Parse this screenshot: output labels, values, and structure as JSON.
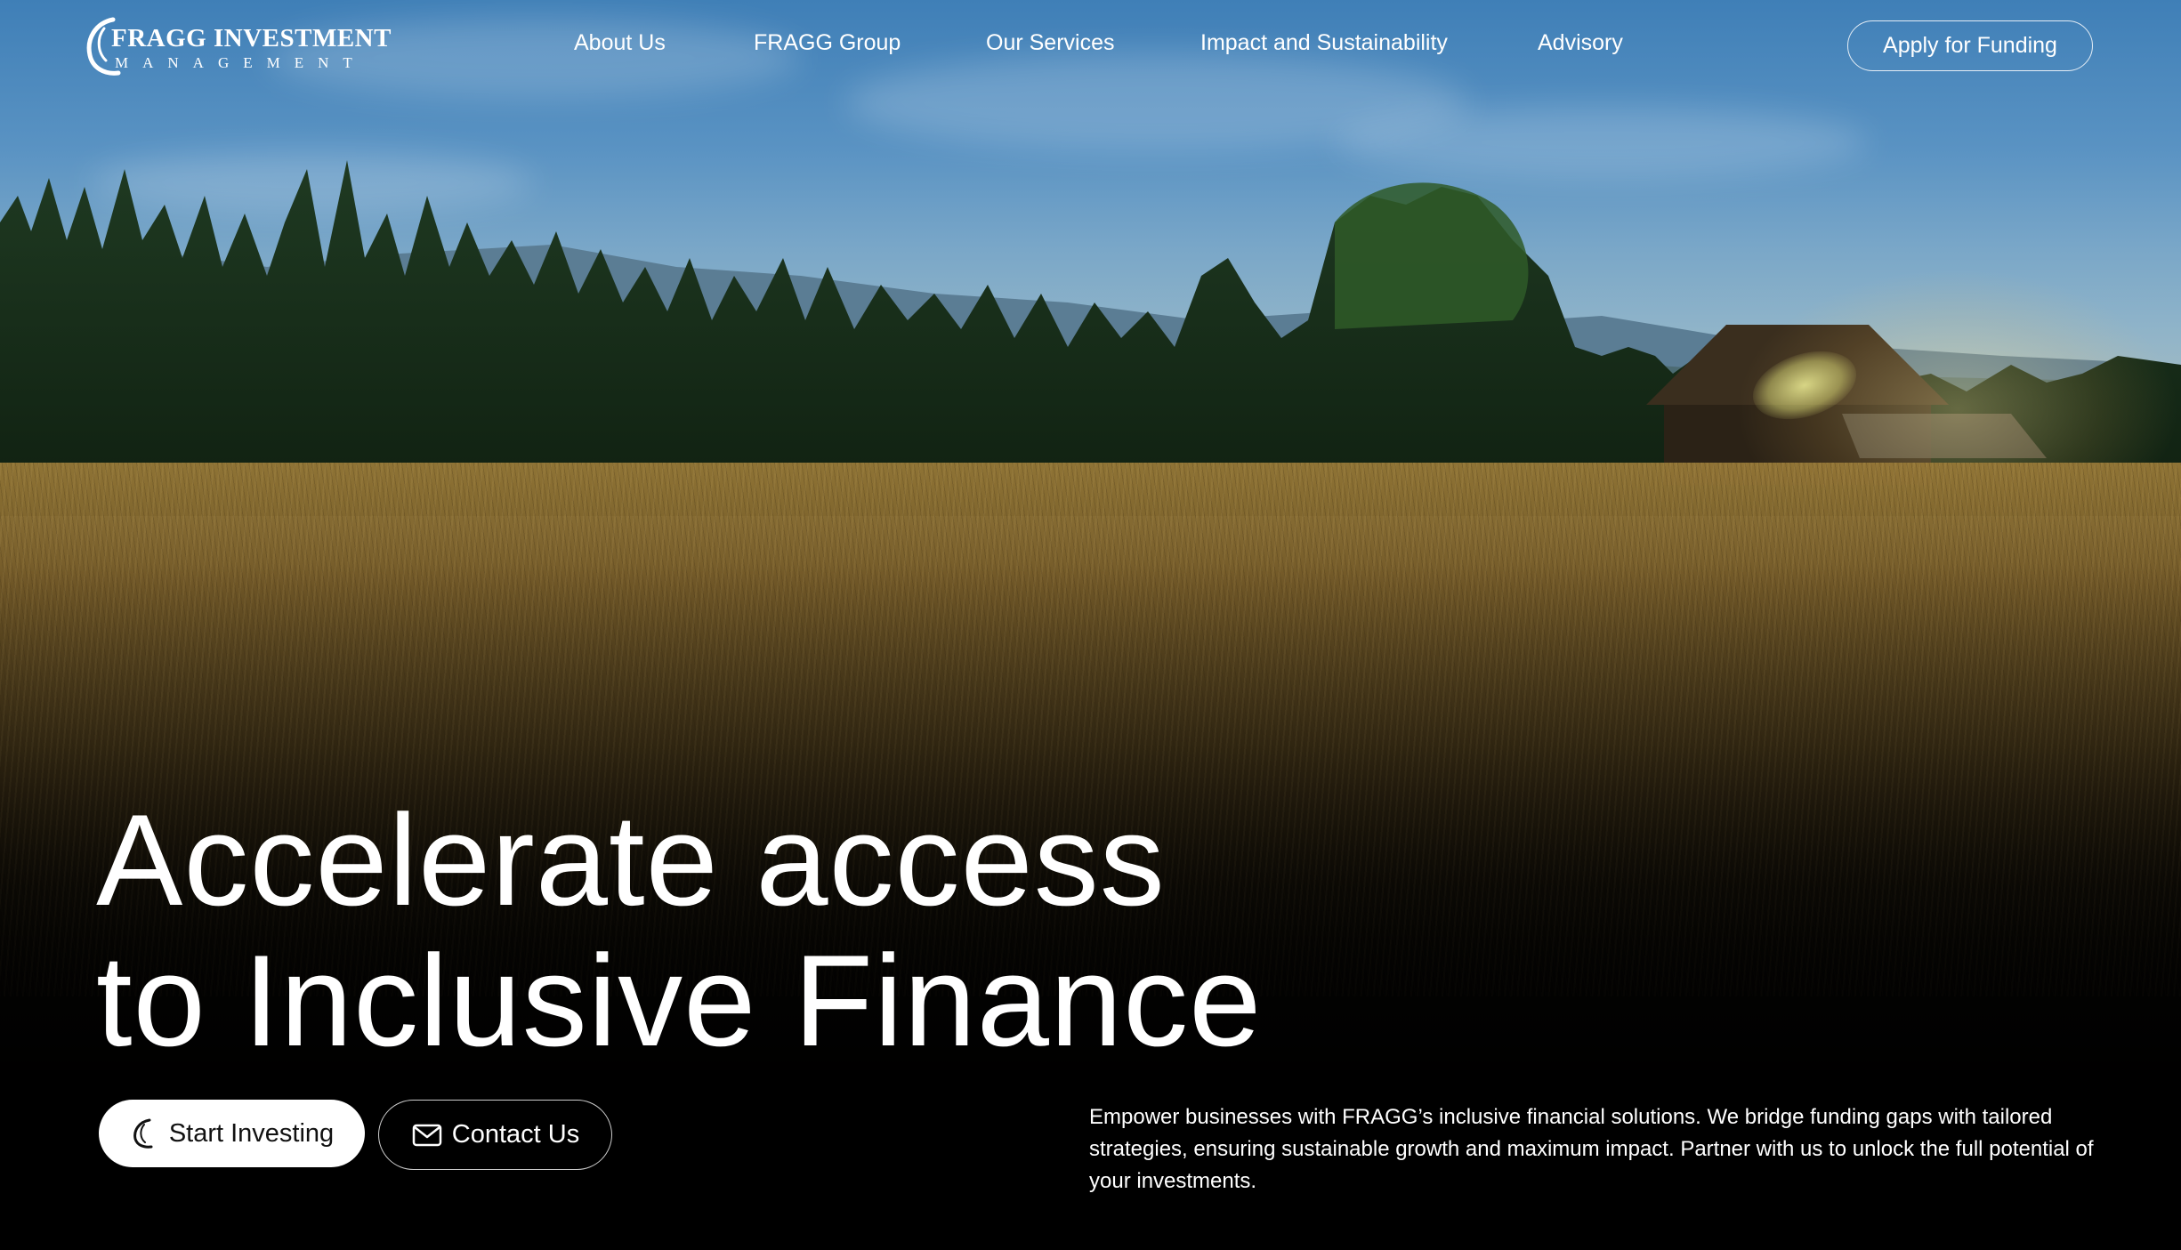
{
  "brand": {
    "name": "FRAGG INVESTMENT",
    "tagline": "MANAGEMENT",
    "logo_icon": "swirl-icon"
  },
  "nav": {
    "items": [
      {
        "label": "About Us"
      },
      {
        "label": "FRAGG Group"
      },
      {
        "label": "Our Services"
      },
      {
        "label": "Impact and Sustainability"
      },
      {
        "label": "Advisory"
      }
    ],
    "cta_label": "Apply for Funding"
  },
  "hero": {
    "headline_line1": "Accelerate access",
    "headline_line2": "to Inclusive Finance",
    "primary_button": {
      "label": "Start Investing",
      "icon": "swirl-icon"
    },
    "secondary_button": {
      "label": "Contact Us",
      "icon": "mail-icon"
    },
    "description": "Empower businesses with FRAGG’s inclusive financial solutions. We bridge funding gaps with tailored strategies, ensuring sustainable growth and maximum impact. Partner with us to unlock the full potential of your investments."
  },
  "colors": {
    "text": "#ffffff",
    "button_bg": "#ffffff",
    "button_text": "#111111",
    "page_bottom": "#000000"
  }
}
